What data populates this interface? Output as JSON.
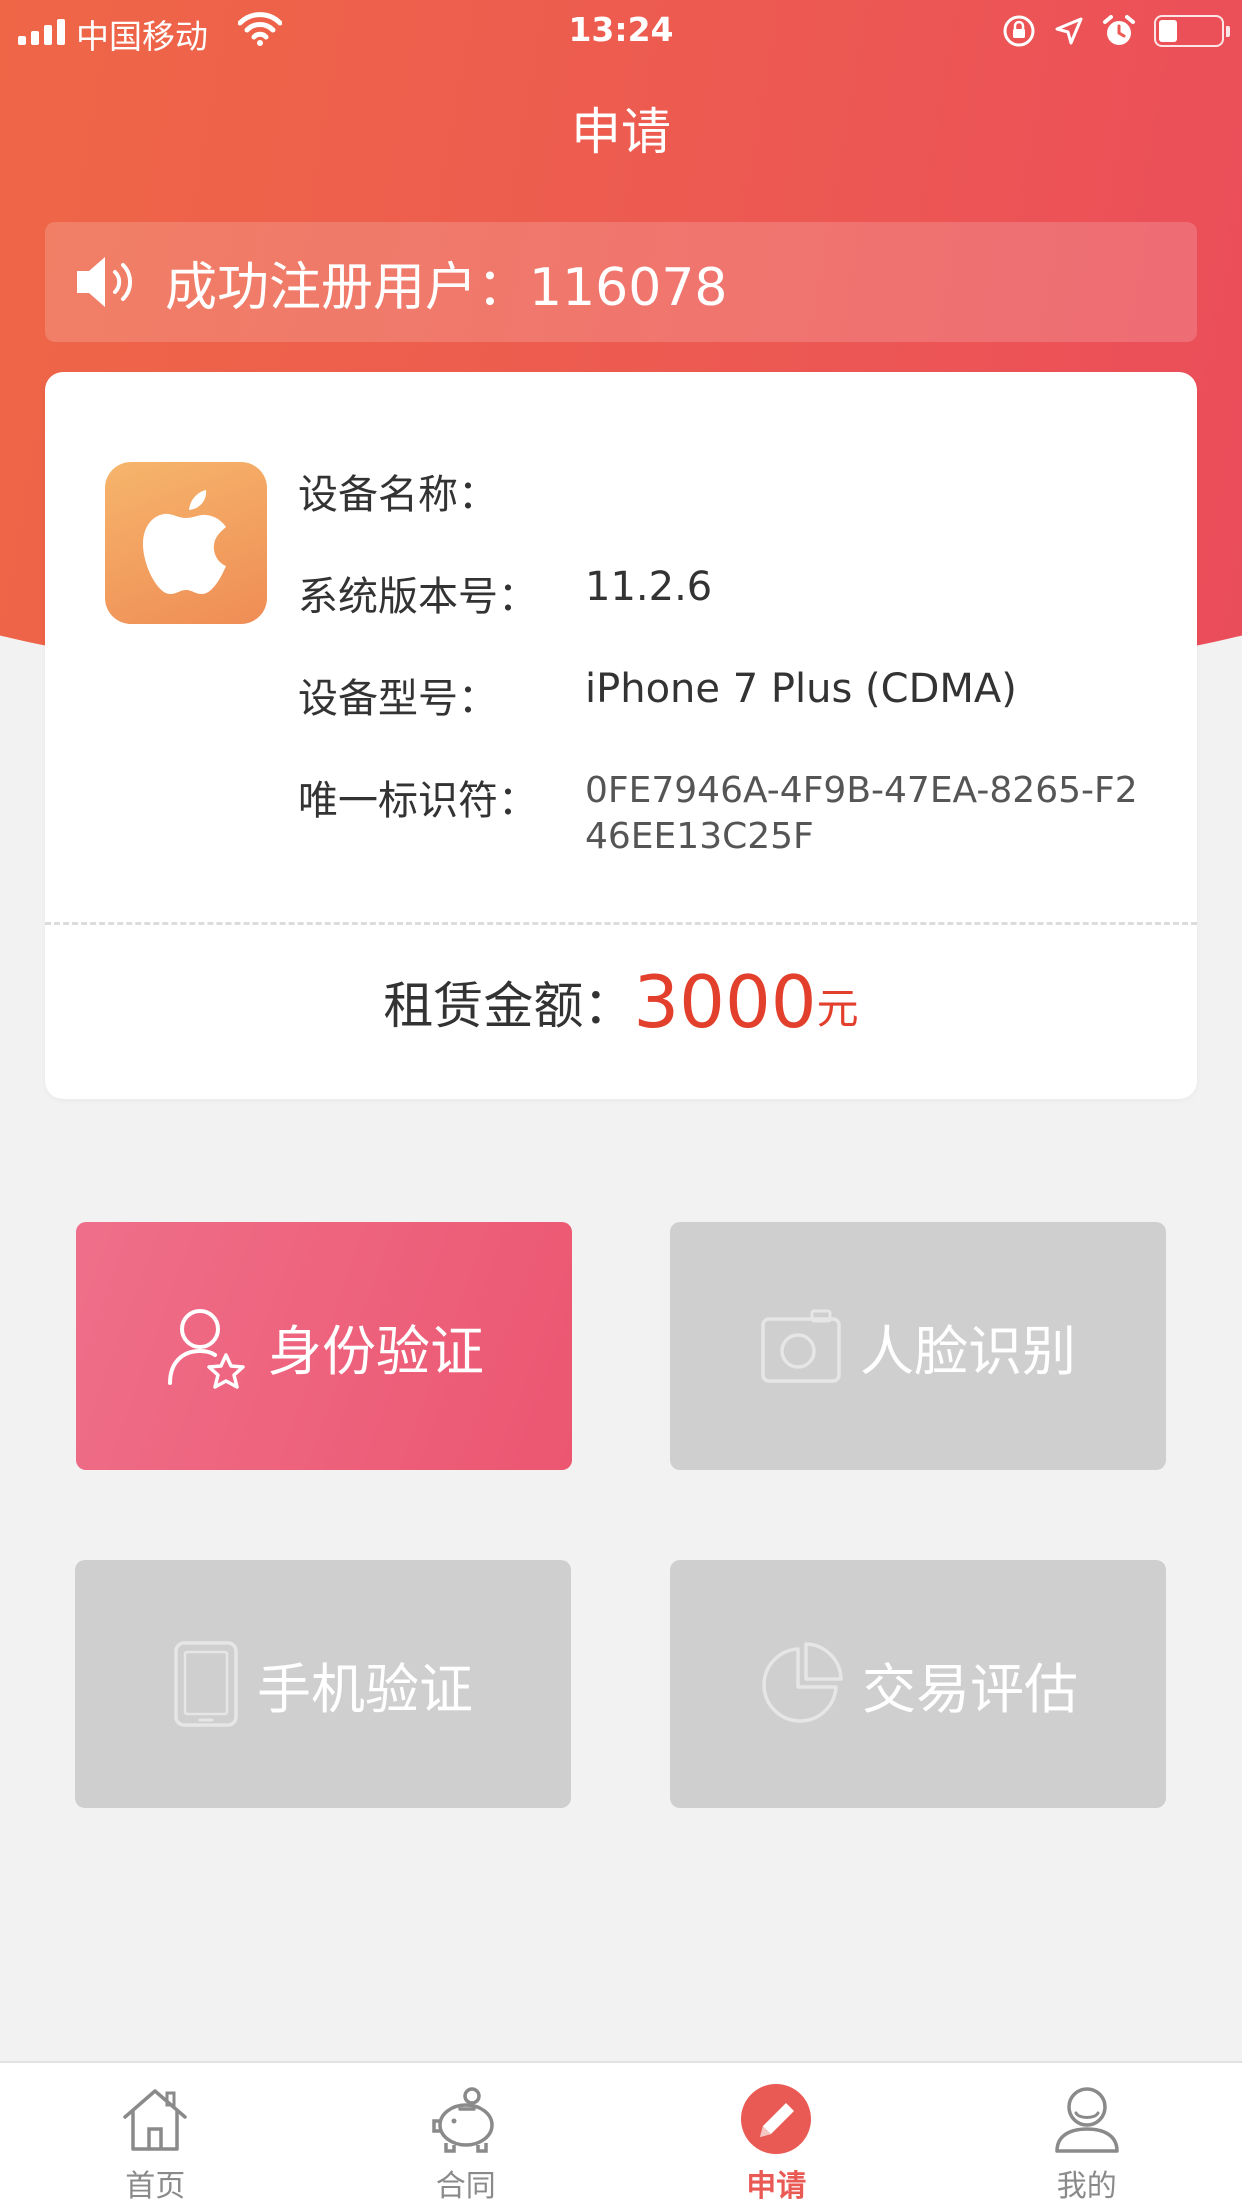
{
  "status_bar": {
    "carrier": "中国移动",
    "time": "13:24",
    "battery_level": 0.3
  },
  "header": {
    "title": "申请"
  },
  "notice": {
    "icon": "speaker-icon",
    "text": "成功注册用户：116078"
  },
  "device": {
    "icon": "apple-logo-icon",
    "name_label": "设备名称：",
    "name_value": "",
    "os_label": "系统版本号：",
    "os_value": "11.2.6",
    "model_label": "设备型号：",
    "model_value": "iPhone 7 Plus (CDMA)",
    "uid_label": "唯一标识符：",
    "uid_value": "0FE7946A-4F9B-47EA-8265-F246EE13C25F",
    "amount_label": "租赁金额：",
    "amount_value": "3000",
    "amount_unit": "元"
  },
  "actions": [
    {
      "label": "身份验证",
      "icon": "user-star-icon",
      "active": true
    },
    {
      "label": "人脸识别",
      "icon": "camera-icon",
      "active": false
    },
    {
      "label": "手机验证",
      "icon": "phone-icon",
      "active": false
    },
    {
      "label": "交易评估",
      "icon": "pie-chart-icon",
      "active": false
    }
  ],
  "tabs": [
    {
      "label": "首页",
      "icon": "home-icon"
    },
    {
      "label": "合同",
      "icon": "piggy-bank-icon"
    },
    {
      "label": "申请",
      "icon": "edit-pen-icon",
      "active": true
    },
    {
      "label": "我的",
      "icon": "profile-icon"
    }
  ],
  "colors": {
    "header_start": "#ee6944",
    "header_end": "#ea4a5c",
    "accent": "#e2402d",
    "active_tile": "#ee6480",
    "inactive_tile": "#cfcfcf",
    "tab_active": "#ea5a55"
  }
}
